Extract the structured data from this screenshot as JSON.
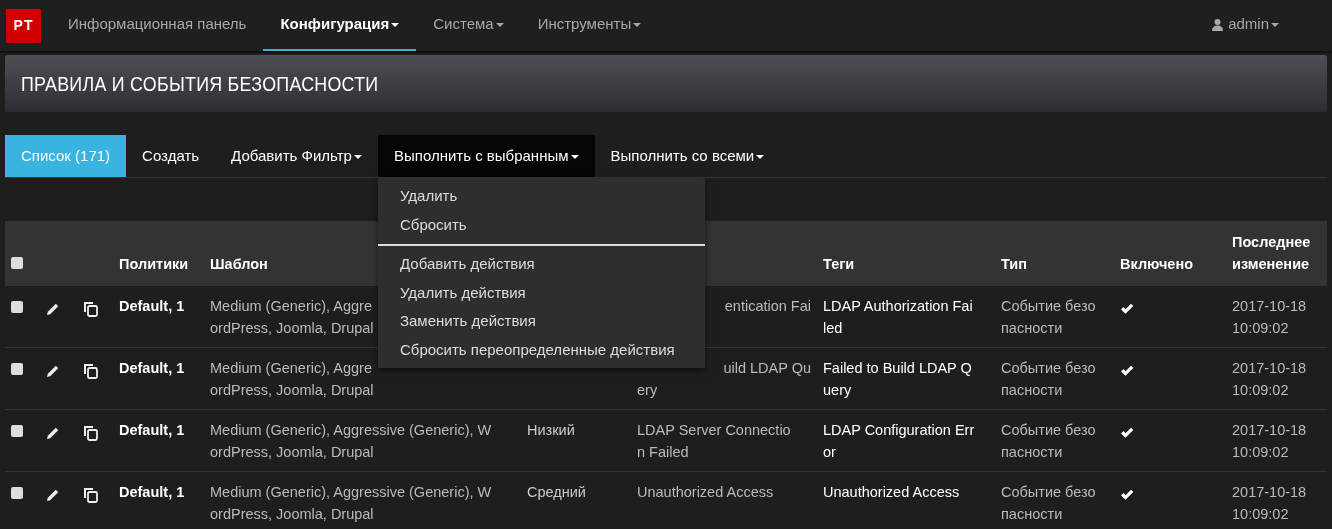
{
  "navbar": {
    "logo": "PT",
    "items": [
      {
        "label": "Информационная панель",
        "selected": false,
        "dropdown": false
      },
      {
        "label": "Конфигурация",
        "selected": true,
        "dropdown": true
      },
      {
        "label": "Система",
        "selected": false,
        "dropdown": true
      },
      {
        "label": "Инструменты",
        "selected": false,
        "dropdown": true
      }
    ],
    "user": {
      "label": "admin",
      "dropdown": true
    }
  },
  "page_title": "ПРАВИЛА И СОБЫТИЯ БЕЗОПАСНОСТИ",
  "toolbar": [
    {
      "label": "Список (171)",
      "selected": true,
      "dropdown": false,
      "open": false
    },
    {
      "label": "Создать",
      "selected": false,
      "dropdown": false,
      "open": false
    },
    {
      "label": "Добавить Фильтр",
      "selected": false,
      "dropdown": true,
      "open": false
    },
    {
      "label": "Выполнить с выбранным",
      "selected": false,
      "dropdown": true,
      "open": true
    },
    {
      "label": "Выполнить со всеми",
      "selected": false,
      "dropdown": true,
      "open": false
    }
  ],
  "menu": {
    "groups": [
      [
        "Удалить",
        "Сбросить"
      ],
      [
        "Добавить действия",
        "Удалить действия",
        "Заменить действия",
        "Сбросить переопределенные действия"
      ]
    ]
  },
  "table": {
    "select_all": {
      "checked": false
    },
    "header": {
      "policies": "Политики",
      "template": "Шаблон",
      "tags": "Теги",
      "type": "Тип",
      "enabled": "Включено",
      "modified": "Последнее изменение"
    },
    "rows": [
      {
        "checked": false,
        "policies": "Default, 1",
        "template": [
          "Medium (Generic), Aggre",
          "ordPress, Joomla, Drupal"
        ],
        "description": [
          "entication Fai"
        ],
        "description_cut": true,
        "tags": [
          "LDAP Authorization Fai",
          "led"
        ],
        "type": [
          "Событие безо",
          "пасности"
        ],
        "enabled": true,
        "modified": [
          "2017-10-18",
          "10:09:02"
        ]
      },
      {
        "checked": false,
        "policies": "Default, 1",
        "template": [
          "Medium (Generic), Aggre",
          "ordPress, Joomla, Drupal"
        ],
        "description": [
          "uild LDAP Qu",
          "ery"
        ],
        "description_cut": true,
        "tags": [
          "Failed to Build LDAP Q",
          "uery"
        ],
        "type": [
          "Событие безо",
          "пасности"
        ],
        "enabled": true,
        "modified": [
          "2017-10-18",
          "10:09:02"
        ]
      },
      {
        "checked": false,
        "policies": "Default, 1",
        "template": [
          "Medium (Generic), Aggressive (Generic), W",
          "ordPress, Joomla, Drupal"
        ],
        "level": "Низкий",
        "description": [
          "LDAP Server Connectio",
          "n Failed"
        ],
        "description_cut": false,
        "tags": [
          "LDAP Configuration Err",
          "or"
        ],
        "type": [
          "Событие безо",
          "пасности"
        ],
        "enabled": true,
        "modified": [
          "2017-10-18",
          "10:09:02"
        ]
      },
      {
        "checked": false,
        "policies": "Default, 1",
        "template": [
          "Medium (Generic), Aggressive (Generic), W",
          "ordPress, Joomla, Drupal"
        ],
        "level": "Средний",
        "description": [
          "Unauthorized Access"
        ],
        "description_cut": false,
        "tags": [
          "Unauthorized Access"
        ],
        "type": [
          "Событие безо",
          "пасности"
        ],
        "enabled": true,
        "modified": [
          "2017-10-18",
          "10:09:02"
        ]
      }
    ]
  }
}
